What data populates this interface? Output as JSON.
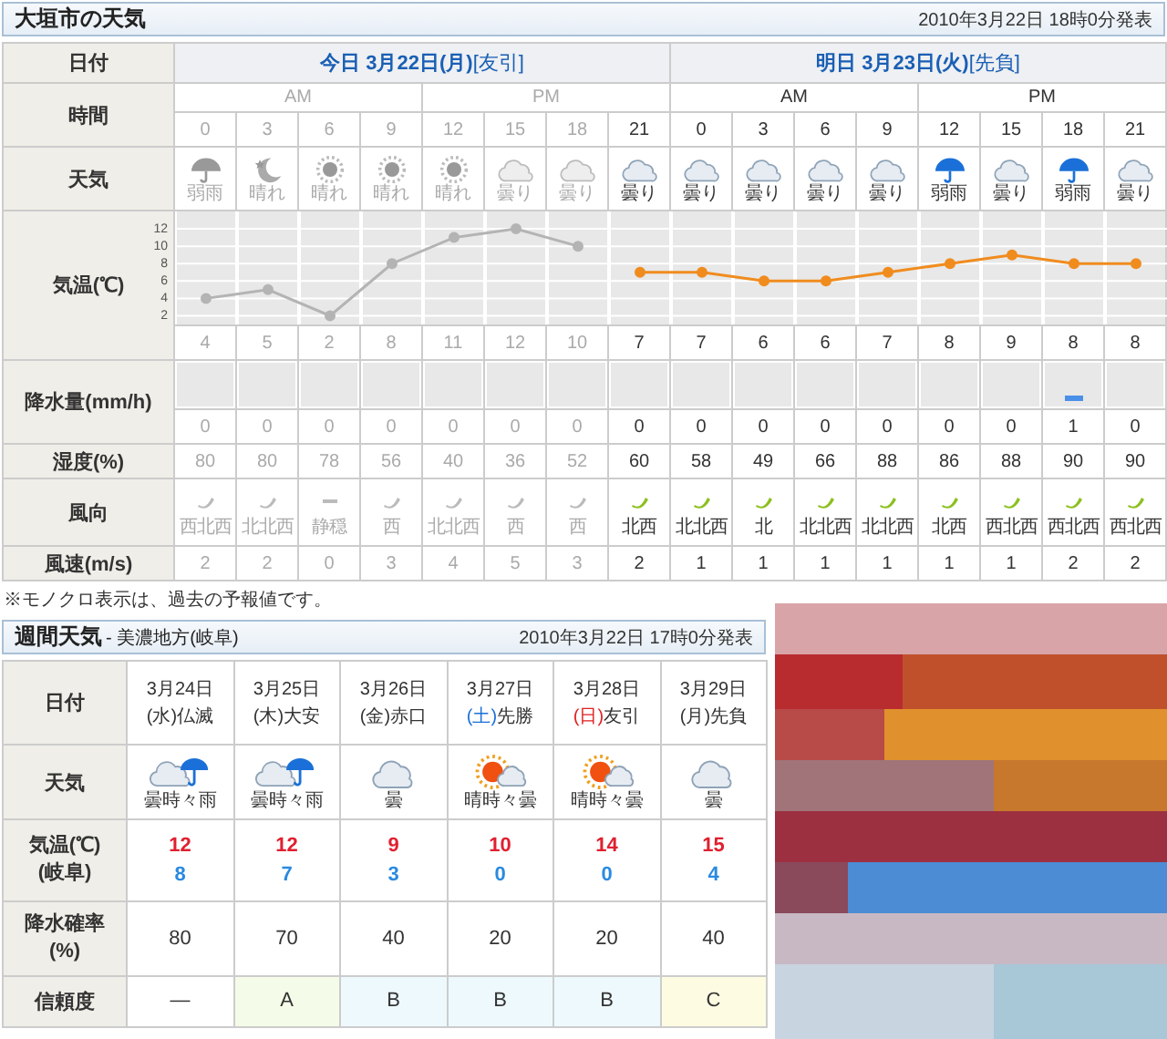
{
  "forecast": {
    "title": "大垣市の天気",
    "issued": "2010年3月22日 18時0分発表",
    "labels": {
      "date": "日付",
      "time": "時間",
      "weather": "天気",
      "temp": "気温(℃)",
      "precip": "降水量(mm/h)",
      "humidity": "湿度(%)",
      "wind_dir": "風向",
      "wind_speed": "風速(m/s)"
    },
    "days": [
      {
        "label": "今日 3月22日(月)",
        "rokuyo": "[友引]"
      },
      {
        "label": "明日 3月23日(火)",
        "rokuyo": "[先負]"
      }
    ],
    "periods": [
      {
        "label": "AM",
        "past": true
      },
      {
        "label": "PM",
        "past": true
      },
      {
        "label": "AM",
        "past": false
      },
      {
        "label": "PM",
        "past": false
      }
    ],
    "hours": [
      {
        "hour": "0",
        "past": true,
        "weather": {
          "kind": "rain",
          "text": "弱雨"
        },
        "temp": "4",
        "precip": "0",
        "humidity": "80",
        "wind": {
          "kind": "arrow",
          "direction": "西北西",
          "speed": "2"
        }
      },
      {
        "hour": "3",
        "past": true,
        "weather": {
          "kind": "clear_night",
          "text": "晴れ"
        },
        "temp": "5",
        "precip": "0",
        "humidity": "80",
        "wind": {
          "kind": "arrow",
          "direction": "北北西",
          "speed": "2"
        }
      },
      {
        "hour": "6",
        "past": true,
        "weather": {
          "kind": "sunny",
          "text": "晴れ"
        },
        "temp": "2",
        "precip": "0",
        "humidity": "78",
        "wind": {
          "kind": "calm",
          "direction": "静穏",
          "speed": "0"
        }
      },
      {
        "hour": "9",
        "past": true,
        "weather": {
          "kind": "sunny",
          "text": "晴れ"
        },
        "temp": "8",
        "precip": "0",
        "humidity": "56",
        "wind": {
          "kind": "arrow",
          "direction": "西",
          "speed": "3"
        }
      },
      {
        "hour": "12",
        "past": true,
        "weather": {
          "kind": "sunny",
          "text": "晴れ"
        },
        "temp": "11",
        "precip": "0",
        "humidity": "40",
        "wind": {
          "kind": "arrow",
          "direction": "北北西",
          "speed": "4"
        }
      },
      {
        "hour": "15",
        "past": true,
        "weather": {
          "kind": "cloudy",
          "text": "曇り"
        },
        "temp": "12",
        "precip": "0",
        "humidity": "36",
        "wind": {
          "kind": "arrow",
          "direction": "西",
          "speed": "5"
        }
      },
      {
        "hour": "18",
        "past": true,
        "weather": {
          "kind": "cloudy",
          "text": "曇り"
        },
        "temp": "10",
        "precip": "0",
        "humidity": "52",
        "wind": {
          "kind": "arrow",
          "direction": "西",
          "speed": "3"
        }
      },
      {
        "hour": "21",
        "past": false,
        "weather": {
          "kind": "cloudy",
          "text": "曇り"
        },
        "temp": "7",
        "precip": "0",
        "humidity": "60",
        "wind": {
          "kind": "arrow",
          "direction": "北西",
          "speed": "2"
        }
      },
      {
        "hour": "0",
        "past": false,
        "weather": {
          "kind": "cloudy",
          "text": "曇り"
        },
        "temp": "7",
        "precip": "0",
        "humidity": "58",
        "wind": {
          "kind": "arrow",
          "direction": "北北西",
          "speed": "1"
        }
      },
      {
        "hour": "3",
        "past": false,
        "weather": {
          "kind": "cloudy",
          "text": "曇り"
        },
        "temp": "6",
        "precip": "0",
        "humidity": "49",
        "wind": {
          "kind": "arrow",
          "direction": "北",
          "speed": "1"
        }
      },
      {
        "hour": "6",
        "past": false,
        "weather": {
          "kind": "cloudy",
          "text": "曇り"
        },
        "temp": "6",
        "precip": "0",
        "humidity": "66",
        "wind": {
          "kind": "arrow",
          "direction": "北北西",
          "speed": "1"
        }
      },
      {
        "hour": "9",
        "past": false,
        "weather": {
          "kind": "cloudy",
          "text": "曇り"
        },
        "temp": "7",
        "precip": "0",
        "humidity": "88",
        "wind": {
          "kind": "arrow",
          "direction": "北北西",
          "speed": "1"
        }
      },
      {
        "hour": "12",
        "past": false,
        "weather": {
          "kind": "rain",
          "text": "弱雨"
        },
        "temp": "8",
        "precip": "0",
        "humidity": "86",
        "wind": {
          "kind": "arrow",
          "direction": "北西",
          "speed": "1"
        }
      },
      {
        "hour": "15",
        "past": false,
        "weather": {
          "kind": "cloudy",
          "text": "曇り"
        },
        "temp": "9",
        "precip": "0",
        "humidity": "88",
        "wind": {
          "kind": "arrow",
          "direction": "西北西",
          "speed": "1"
        }
      },
      {
        "hour": "18",
        "past": false,
        "weather": {
          "kind": "rain",
          "text": "弱雨"
        },
        "temp": "8",
        "precip": "1",
        "humidity": "90",
        "wind": {
          "kind": "arrow",
          "direction": "西北西",
          "speed": "2"
        }
      },
      {
        "hour": "21",
        "past": false,
        "weather": {
          "kind": "cloudy",
          "text": "曇り"
        },
        "temp": "8",
        "precip": "0",
        "humidity": "90",
        "wind": {
          "kind": "arrow",
          "direction": "西北西",
          "speed": "2"
        }
      }
    ],
    "chart_data": {
      "type": "line",
      "ylim": [
        1,
        14
      ],
      "yticks": [
        2,
        4,
        6,
        8,
        10,
        12
      ],
      "grid": true,
      "series": [
        {
          "color": "#b4b4b4",
          "marker": "circle",
          "values": [
            4,
            5,
            2,
            8,
            11,
            12,
            10,
            null,
            null,
            null,
            null,
            null,
            null,
            null,
            null,
            null
          ]
        },
        {
          "color": "#f08c1e",
          "marker": "circle",
          "values": [
            null,
            null,
            null,
            null,
            null,
            null,
            null,
            7,
            7,
            6,
            6,
            7,
            8,
            9,
            8,
            8
          ]
        }
      ]
    },
    "note": "※モノクロ表示は、過去の予報値です。"
  },
  "weekly": {
    "title": "週間天気",
    "region": "- 美濃地方(岐阜)",
    "issued": "2010年3月22日 17時0分発表",
    "labels": {
      "date": "日付",
      "weather": "天気",
      "temp": "気温(℃)\n(岐阜)",
      "pop": "降水確率\n(%)",
      "reliability": "信頼度"
    },
    "days": [
      {
        "date": "3月24日",
        "weekday": "(水)",
        "kind": "weekday",
        "rokuyo": "仏滅",
        "weather": {
          "kind": "cloud_rain",
          "text": "曇時々雨"
        },
        "high": "12",
        "low": "8",
        "pop": "80",
        "reliability": "—",
        "color": "#ffffff"
      },
      {
        "date": "3月25日",
        "weekday": "(木)",
        "kind": "weekday",
        "rokuyo": "大安",
        "weather": {
          "kind": "cloud_rain",
          "text": "曇時々雨"
        },
        "high": "12",
        "low": "7",
        "pop": "70",
        "reliability": "A",
        "color": "#f4fbe8"
      },
      {
        "date": "3月26日",
        "weekday": "(金)",
        "kind": "weekday",
        "rokuyo": "赤口",
        "weather": {
          "kind": "cloud",
          "text": "曇"
        },
        "high": "9",
        "low": "3",
        "pop": "40",
        "reliability": "B",
        "color": "#eef9fd"
      },
      {
        "date": "3月27日",
        "weekday": "(土)",
        "kind": "saturday",
        "rokuyo": "先勝",
        "weather": {
          "kind": "sun_cloud",
          "text": "晴時々曇"
        },
        "high": "10",
        "low": "0",
        "pop": "20",
        "reliability": "B",
        "color": "#eef9fd"
      },
      {
        "date": "3月28日",
        "weekday": "(日)",
        "kind": "sunday",
        "rokuyo": "友引",
        "weather": {
          "kind": "sun_cloud",
          "text": "晴時々曇"
        },
        "high": "14",
        "low": "0",
        "pop": "20",
        "reliability": "B",
        "color": "#eef9fd"
      },
      {
        "date": "3月29日",
        "weekday": "(月)",
        "kind": "weekday",
        "rokuyo": "先負",
        "weather": {
          "kind": "cloud",
          "text": "曇"
        },
        "high": "15",
        "low": "4",
        "pop": "40",
        "reliability": "C",
        "color": "#fdfbe2"
      }
    ]
  }
}
